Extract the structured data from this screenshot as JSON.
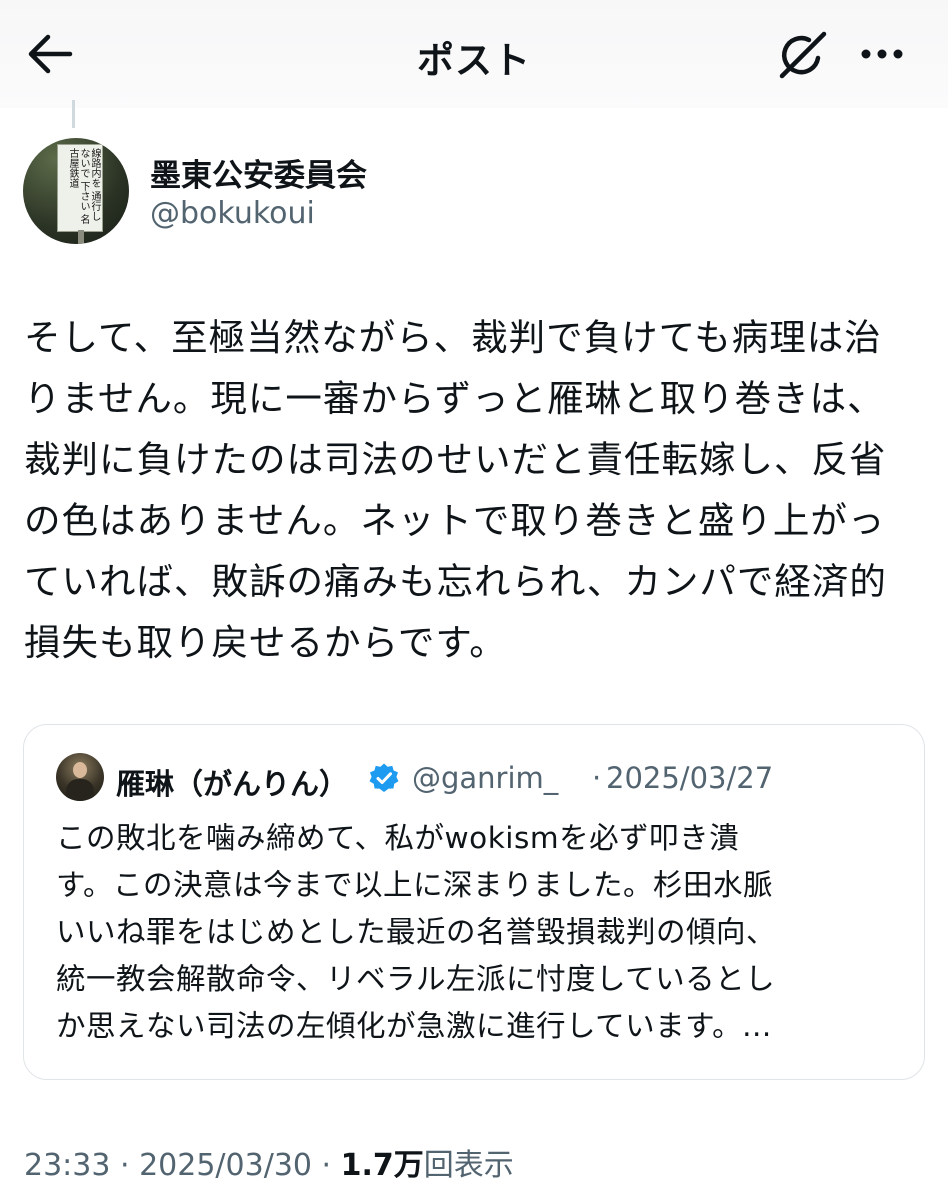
{
  "header": {
    "title": "ポスト"
  },
  "author": {
    "display_name": "墨東公安委員会",
    "handle": "@bokukoui",
    "avatar_sign_text": "線路内を 通行しないで 下さい 名古屋鉄道"
  },
  "post": {
    "text": "そして、至極当然ながら、裁判で負けても病理は治\nりません。現に一審からずっと雁琳と取り巻きは、\n裁判に負けたのは司法のせいだと責任転嫁し、反省\nの色はありません。ネットで取り巻きと盛り上がっ\nていれば、敗訴の痛みも忘れられ、カンパで経済的\n損失も取り戻せるからです。"
  },
  "quote": {
    "display_name": "雁琳（がんりん）",
    "handle": "@ganrim_",
    "separator": "·",
    "date": "2025/03/27",
    "text": "この敗北を噛み締めて、私がwokismを必ず叩き潰\nす。この決意は今まで以上に深まりました。杉田水脈\nいいね罪をはじめとした最近の名誉毀損裁判の傾向、\n統一教会解散命令、リベラル左派に忖度しているとし\nか思えない司法の左傾化が急激に進行しています。..."
  },
  "meta": {
    "time": "23:33",
    "sep1": " · ",
    "date": "2025/03/30",
    "sep2": " · ",
    "views_count": "1.7万",
    "views_label": "回表示"
  },
  "colors": {
    "text_primary": "#0f1419",
    "text_secondary": "#536471",
    "verified_blue": "#1d9bf0",
    "border": "#dfe4e7"
  },
  "icons": {
    "back": "arrow-left-icon",
    "grok": "grok-icon",
    "more": "more-horizontal-icon",
    "verified": "verified-badge-icon"
  }
}
